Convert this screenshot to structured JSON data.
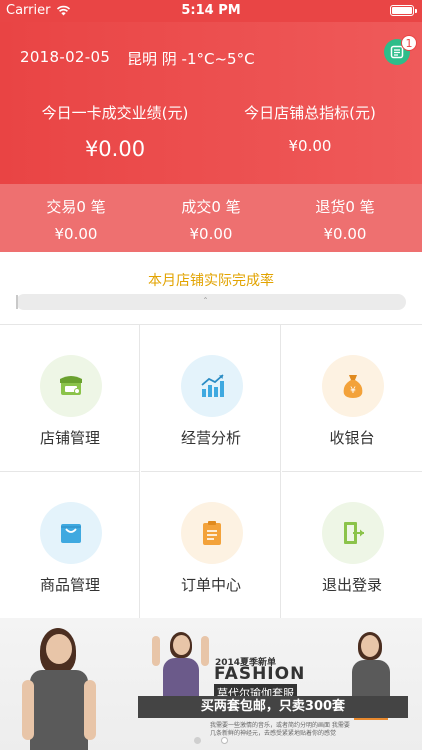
{
  "status_bar": {
    "carrier": "Carrier",
    "time": "5:14 PM"
  },
  "header": {
    "date": "2018-02-05",
    "weather": "昆明 阴 -1°C~5°C",
    "message_badge": "1",
    "kpi_left": {
      "label": "今日一卡成交业绩(元)",
      "value": "¥0.00"
    },
    "kpi_right": {
      "label": "今日店铺总指标(元)",
      "value": "¥0.00"
    }
  },
  "stats": [
    {
      "label": "交易0 笔",
      "value": "¥0.00"
    },
    {
      "label": "成交0 笔",
      "value": "¥0.00"
    },
    {
      "label": "退货0 笔",
      "value": "¥0.00"
    }
  ],
  "progress": {
    "title": "本月店铺实际完成率",
    "fraction": 0.0
  },
  "menu": [
    {
      "label": "店铺管理",
      "icon": "store-icon",
      "bg": "#eef6e6",
      "color": "#8bc34a"
    },
    {
      "label": "经营分析",
      "icon": "chart-icon",
      "bg": "#e4f3fb",
      "color": "#3fa9e0"
    },
    {
      "label": "收银台",
      "icon": "money-bag-icon",
      "bg": "#fdf2e2",
      "color": "#f3a23a"
    },
    {
      "label": "商品管理",
      "icon": "shopping-bag-icon",
      "bg": "#e4f3fb",
      "color": "#3fa9e0"
    },
    {
      "label": "订单中心",
      "icon": "clipboard-icon",
      "bg": "#fdf2e2",
      "color": "#f3a23a"
    },
    {
      "label": "退出登录",
      "icon": "exit-icon",
      "bg": "#eef6e6",
      "color": "#8bc34a"
    }
  ],
  "banner": {
    "year_text": "2014夏季新单",
    "headline": "FASHION",
    "brand": "莫代尔瑜伽套服",
    "promo": "买两套包邮，只卖300套",
    "desc": "我需要一些激情的音乐，或者简约分明的画面 我需要几条新鲜的神经元，去感受紧紧地贴着你的感觉"
  },
  "colors": {
    "header_red": "#e94444",
    "substrip_red": "#ee7070",
    "progress_title": "#e2a300",
    "badge_green": "#2ebd8a"
  }
}
